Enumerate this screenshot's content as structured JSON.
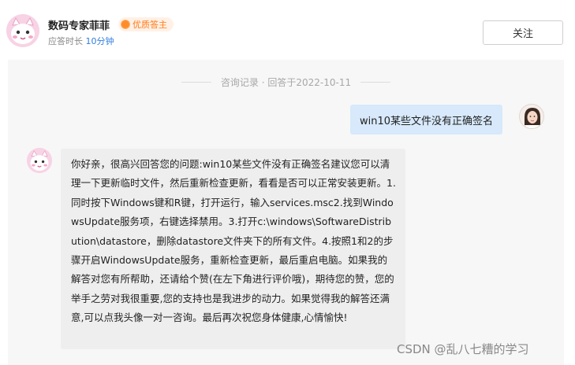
{
  "header": {
    "expert_name": "数码专家菲菲",
    "badge_label": "优质答主",
    "response_prefix": "应答时长",
    "response_value": "10分钟",
    "follow_label": "关注"
  },
  "consult": {
    "record_label": "咨询记录 · 回答于2022-10-11",
    "question": "win10某些文件没有正确签名",
    "answer": "你好亲，很高兴回答您的问题:win10某些文件没有正确签名建议您可以清理一下更新临时文件，然后重新检查更新，看看是否可以正常安装更新。1.同时按下Windows键和R键，打开运行，输入services.msc2.找到WindowsUpdate服务项，右键选择禁用。3.打开c:\\windows\\SoftwareDistribution\\datastore，删除datastore文件夹下的所有文件。4.按照1和2的步骤开启WindowsUpdate服务，重新检查更新，最后重启电脑。如果我的解答对您有所帮助，还请给个赞(在左下角进行评价哦)，期待您的赞，您的举手之劳对我很重要,您的支持也是我进步的动力。如果觉得我的解答还满意,可以点我头像一对一咨询。最后再次祝您身体健康,心情愉快!"
  },
  "watermark": "CSDN @乱八七糟的学习",
  "colors": {
    "accent_blue": "#2f7de1",
    "badge_orange": "#ff7a1a",
    "question_bubble": "#d7e9fb",
    "answer_bubble": "#eeeeee"
  },
  "icons": {
    "expert_avatar": "cartoon-cat-avatar",
    "badge": "medal-icon",
    "user_avatar": "user-photo-avatar"
  }
}
